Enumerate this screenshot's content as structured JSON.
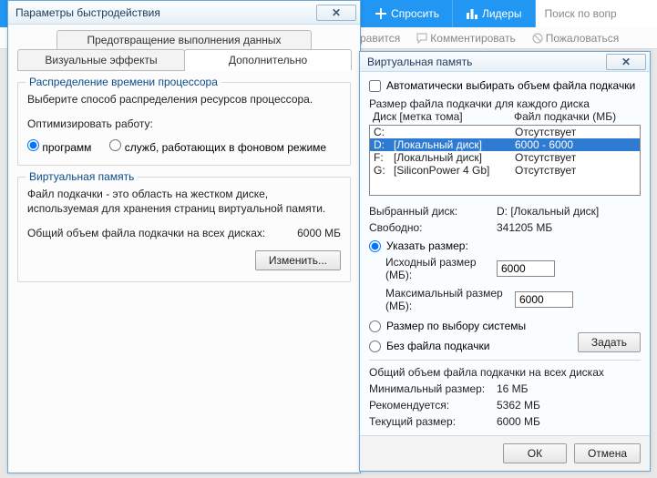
{
  "topbar": {
    "ask": "Спросить",
    "leaders": "Лидеры",
    "search_placeholder": "Поиск по вопр"
  },
  "belowbar": {
    "like": "равится",
    "comment": "Комментировать",
    "report": "Пожаловаться"
  },
  "main": {
    "title": "Параметры быстродействия",
    "tab_top": "Предотвращение выполнения данных",
    "tab_visual": "Визуальные эффекты",
    "tab_advanced": "Дополнительно",
    "cpu": {
      "legend": "Распределение времени процессора",
      "desc": "Выберите способ распределения ресурсов процессора.",
      "optimize": "Оптимизировать работу:",
      "opt_programs": "программ",
      "opt_services": "служб, работающих в фоновом режиме"
    },
    "vm": {
      "legend": "Виртуальная память",
      "desc": "Файл подкачки - это область на жестком диске, используемая для хранения страниц виртуальной памяти.",
      "total_label": "Общий объем файла подкачки на всех дисках:",
      "total_value": "6000 МБ",
      "change_btn": "Изменить..."
    }
  },
  "vmem": {
    "title": "Виртуальная память",
    "auto": "Автоматически выбирать объем файла подкачки",
    "each_disk": "Размер файла подкачки для каждого диска",
    "hdr_disk": "Диск [метка тома]",
    "hdr_pf": "Файл подкачки (МБ)",
    "rows": [
      {
        "d": "C:",
        "lbl": "",
        "pf": "Отсутствует"
      },
      {
        "d": "D:",
        "lbl": "[Локальный диск]",
        "pf": "6000 - 6000"
      },
      {
        "d": "F:",
        "lbl": "[Локальный диск]",
        "pf": "Отсутствует"
      },
      {
        "d": "G:",
        "lbl": "[SiliconPower 4 Gb]",
        "pf": "Отсутствует"
      }
    ],
    "sel_label": "Выбранный диск:",
    "sel_value": "D:   [Локальный диск]",
    "free_label": "Свободно:",
    "free_value": "341205 МБ",
    "custom": "Указать размер:",
    "init_label": "Исходный размер (МБ):",
    "init_value": "6000",
    "max_label": "Максимальный размер (МБ):",
    "max_value": "6000",
    "system": "Размер по выбору системы",
    "none": "Без файла подкачки",
    "set_btn": "Задать",
    "total_hdr": "Общий объем файла подкачки на всех дисках",
    "min_label": "Минимальный размер:",
    "min_value": "16 МБ",
    "rec_label": "Рекомендуется:",
    "rec_value": "5362 МБ",
    "cur_label": "Текущий размер:",
    "cur_value": "6000 МБ",
    "ok": "ОК",
    "cancel": "Отмена"
  }
}
